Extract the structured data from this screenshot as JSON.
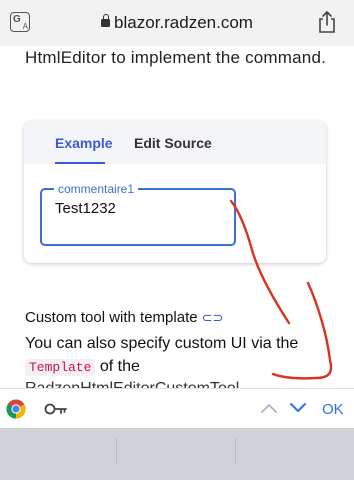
{
  "browser": {
    "url": "blazor.radzen.com",
    "icons": {
      "translate": "translate-icon",
      "lock": "lock-icon",
      "share": "share-icon"
    }
  },
  "page": {
    "intro_text": "HtmlEditor to implement the command."
  },
  "demo_card": {
    "tabs": [
      {
        "label": "Example",
        "active": true
      },
      {
        "label": "Edit Source",
        "active": false
      }
    ],
    "field": {
      "label": "commentaire1",
      "value": "Test1232"
    }
  },
  "section": {
    "heading": "Custom tool with template",
    "link_icon": "link-icon",
    "line1": "You can also specify custom UI via the",
    "code_template": "Template",
    "line2_suffix": "of the",
    "line3": "RadzenHtmlEditorCustomTool"
  },
  "accessory_bar": {
    "ok_label": "OK",
    "icons": [
      "chrome-icon",
      "key-icon",
      "chevron-up-icon",
      "chevron-down-icon"
    ]
  },
  "colors": {
    "accent": "#3b5bd6",
    "field_border": "#3b6fd6",
    "ok_blue": "#2d72e6",
    "annotation_red": "#d9341e",
    "keyboard_gray": "#d0d2d7"
  }
}
